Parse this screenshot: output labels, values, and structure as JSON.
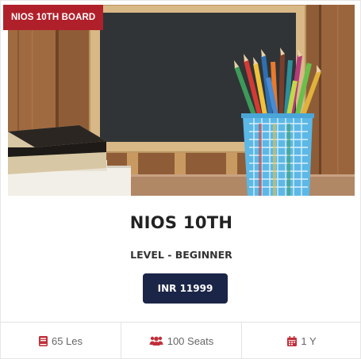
{
  "badge": {
    "label": "NIOS 10TH BOARD"
  },
  "course": {
    "title": "NIOS 10TH",
    "level": "LEVEL - BEGINNER",
    "price": "INR 11999"
  },
  "stats": {
    "lessons": {
      "icon": "book-icon",
      "label": "65 Les"
    },
    "seats": {
      "icon": "users-icon",
      "label": "100 Seats"
    },
    "duration": {
      "icon": "calendar-icon",
      "label": "1 Y"
    }
  },
  "colors": {
    "badge": "#b0202a",
    "button": "#1b2547",
    "icon_accent": "#c0303a"
  }
}
